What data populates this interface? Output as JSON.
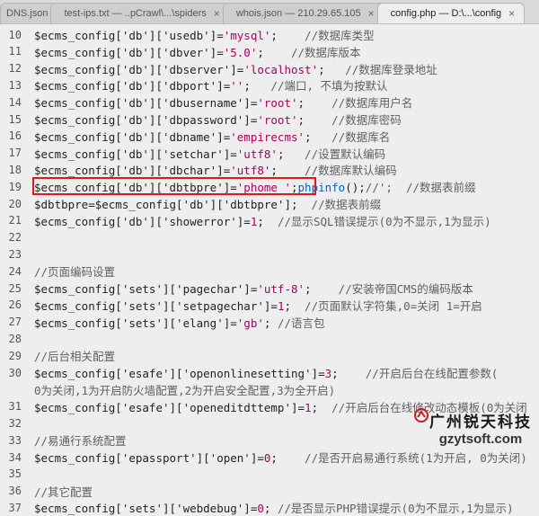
{
  "tabs": [
    {
      "label": "DNS.json",
      "active": false
    },
    {
      "label": "test-ips.txt — ..pCrawl\\...\\spiders",
      "active": false
    },
    {
      "label": "whois.json — 210.29.65.105",
      "active": false
    },
    {
      "label": "config.php — D:\\...\\config",
      "active": true
    }
  ],
  "tab_close": "×",
  "code_lines": [
    {
      "num": "10",
      "tokens": [
        [
          "v",
          "$ecms_config['db']['usedb']"
        ],
        [
          "v",
          "="
        ],
        [
          "s",
          "'mysql'"
        ],
        [
          "v",
          ";"
        ],
        [
          "c",
          "    //数据库类型"
        ]
      ]
    },
    {
      "num": "11",
      "tokens": [
        [
          "v",
          "$ecms_config['db']['dbver']"
        ],
        [
          "v",
          "="
        ],
        [
          "s",
          "'5.0'"
        ],
        [
          "v",
          ";"
        ],
        [
          "c",
          "    //数据库版本"
        ]
      ]
    },
    {
      "num": "12",
      "tokens": [
        [
          "v",
          "$ecms_config['db']['dbserver']"
        ],
        [
          "v",
          "="
        ],
        [
          "s",
          "'localhost'"
        ],
        [
          "v",
          ";"
        ],
        [
          "c",
          "   //数据库登录地址"
        ]
      ]
    },
    {
      "num": "13",
      "tokens": [
        [
          "v",
          "$ecms_config['db']['dbport']"
        ],
        [
          "v",
          "="
        ],
        [
          "s",
          "''"
        ],
        [
          "v",
          ";"
        ],
        [
          "c",
          "   //端口, 不填为按默认"
        ]
      ]
    },
    {
      "num": "14",
      "tokens": [
        [
          "v",
          "$ecms_config['db']['dbusername']"
        ],
        [
          "v",
          "="
        ],
        [
          "s",
          "'root'"
        ],
        [
          "v",
          ";"
        ],
        [
          "c",
          "    //数据库用户名"
        ]
      ]
    },
    {
      "num": "15",
      "tokens": [
        [
          "v",
          "$ecms_config['db']['dbpassword']"
        ],
        [
          "v",
          "="
        ],
        [
          "s",
          "'root'"
        ],
        [
          "v",
          ";"
        ],
        [
          "c",
          "    //数据库密码"
        ]
      ]
    },
    {
      "num": "16",
      "tokens": [
        [
          "v",
          "$ecms_config['db']['dbname']"
        ],
        [
          "v",
          "="
        ],
        [
          "s",
          "'empirecms'"
        ],
        [
          "v",
          ";"
        ],
        [
          "c",
          "   //数据库名"
        ]
      ]
    },
    {
      "num": "17",
      "tokens": [
        [
          "v",
          "$ecms_config['db']['setchar']"
        ],
        [
          "v",
          "="
        ],
        [
          "s",
          "'utf8'"
        ],
        [
          "v",
          ";"
        ],
        [
          "c",
          "   //设置默认编码"
        ]
      ]
    },
    {
      "num": "18",
      "tokens": [
        [
          "v",
          "$ecms_config['db']['dbchar']"
        ],
        [
          "v",
          "="
        ],
        [
          "s",
          "'utf8'"
        ],
        [
          "v",
          ";"
        ],
        [
          "c",
          "    //数据库默认编码"
        ]
      ]
    },
    {
      "num": "19",
      "tokens": [
        [
          "v",
          "$ecms_config['db']['dbtbpre']"
        ],
        [
          "v",
          "="
        ],
        [
          "s",
          "'phome_'"
        ],
        [
          "v",
          ";"
        ],
        [
          "f",
          "phpinfo"
        ],
        [
          "v",
          "();"
        ],
        [
          "c",
          "//';  //数据表前缀"
        ]
      ]
    },
    {
      "num": "20",
      "tokens": [
        [
          "v",
          "$dbtbpre=$ecms_config['db']['dbtbpre'];"
        ],
        [
          "c",
          "  //数据表前缀"
        ]
      ]
    },
    {
      "num": "21",
      "tokens": [
        [
          "v",
          "$ecms_config['db']['showerror']"
        ],
        [
          "v",
          "="
        ],
        [
          "n",
          "1"
        ],
        [
          "v",
          ";"
        ],
        [
          "c",
          "  //显示SQL错误提示(0为不显示,1为显示)"
        ]
      ]
    },
    {
      "num": "22",
      "tokens": []
    },
    {
      "num": "23",
      "tokens": []
    },
    {
      "num": "24",
      "tokens": [
        [
          "c",
          "//页面编码设置"
        ]
      ]
    },
    {
      "num": "25",
      "tokens": [
        [
          "v",
          "$ecms_config['sets']['pagechar']"
        ],
        [
          "v",
          "="
        ],
        [
          "s",
          "'utf-8'"
        ],
        [
          "v",
          ";"
        ],
        [
          "c",
          "    //安装帝国CMS的编码版本"
        ]
      ]
    },
    {
      "num": "26",
      "tokens": [
        [
          "v",
          "$ecms_config['sets']['setpagechar']"
        ],
        [
          "v",
          "="
        ],
        [
          "n",
          "1"
        ],
        [
          "v",
          ";"
        ],
        [
          "c",
          "  //页面默认字符集,0=关闭 1=开启"
        ]
      ]
    },
    {
      "num": "27",
      "tokens": [
        [
          "v",
          "$ecms_config['sets']['elang']"
        ],
        [
          "v",
          "="
        ],
        [
          "s",
          "'gb'"
        ],
        [
          "v",
          ";"
        ],
        [
          "c",
          " //语言包"
        ]
      ]
    },
    {
      "num": "28",
      "tokens": []
    },
    {
      "num": "29",
      "tokens": [
        [
          "c",
          "//后台相关配置"
        ]
      ]
    },
    {
      "num": "30",
      "tokens": [
        [
          "v",
          "$ecms_config['esafe']['openonlinesetting']"
        ],
        [
          "v",
          "="
        ],
        [
          "n",
          "3"
        ],
        [
          "v",
          ";"
        ],
        [
          "c",
          "    //开启后台在线配置参数("
        ]
      ]
    },
    {
      "num": "",
      "tokens": [
        [
          "c",
          "0为关闭,1为开启防火墙配置,2为开启安全配置,3为全开启)"
        ]
      ]
    },
    {
      "num": "31",
      "tokens": [
        [
          "v",
          "$ecms_config['esafe']['openeditdttemp']"
        ],
        [
          "v",
          "="
        ],
        [
          "n",
          "1"
        ],
        [
          "v",
          ";"
        ],
        [
          "c",
          "  //开启后台在线修改动态模板(0为关闭"
        ]
      ]
    },
    {
      "num": "32",
      "tokens": []
    },
    {
      "num": "33",
      "tokens": [
        [
          "c",
          "//易通行系统配置"
        ]
      ]
    },
    {
      "num": "34",
      "tokens": [
        [
          "v",
          "$ecms_config['epassport']['open']"
        ],
        [
          "v",
          "="
        ],
        [
          "n",
          "0"
        ],
        [
          "v",
          ";"
        ],
        [
          "c",
          "    //是否开启易通行系统(1为开启, 0为关闭)"
        ]
      ]
    },
    {
      "num": "35",
      "tokens": []
    },
    {
      "num": "36",
      "tokens": [
        [
          "c",
          "//其它配置"
        ]
      ]
    },
    {
      "num": "37",
      "tokens": [
        [
          "v",
          "$ecms_config['sets']['webdebug']"
        ],
        [
          "v",
          "="
        ],
        [
          "n",
          "0"
        ],
        [
          "v",
          ";"
        ],
        [
          "c",
          " //是否显示PHP错误提示(0为不显示,1为显示)"
        ]
      ]
    }
  ],
  "highlight_line": "19",
  "watermark": {
    "top": "广州锐天科技",
    "bottom": "gzytsoft.com"
  }
}
